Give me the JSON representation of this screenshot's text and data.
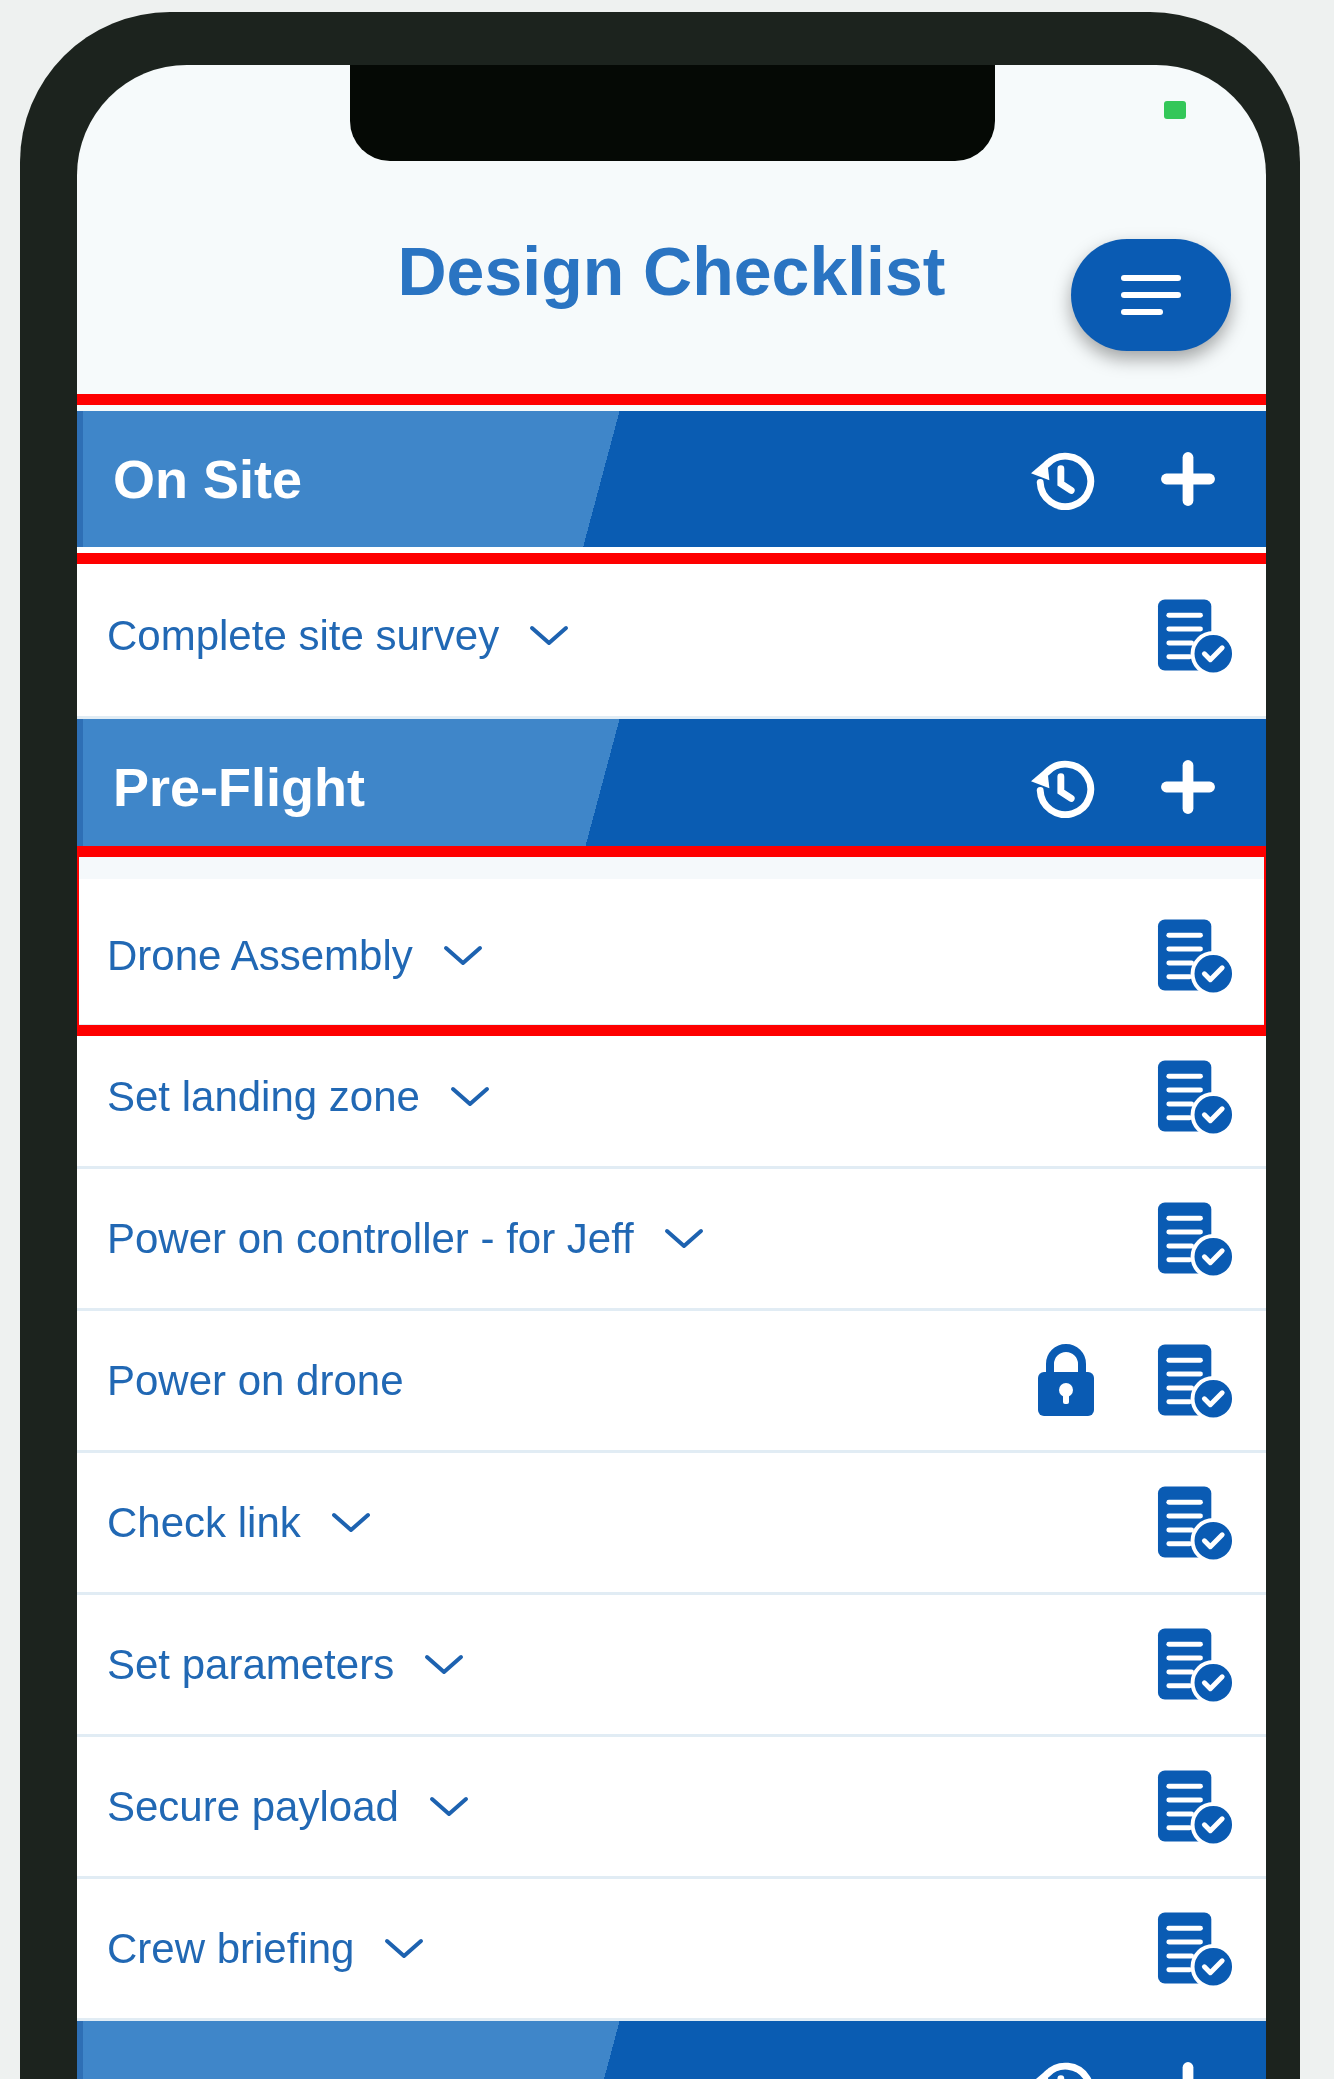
{
  "status_bar": {
    "charging": true
  },
  "title": "Design Checklist",
  "sections": [
    {
      "title": "On Site",
      "highlighted": true,
      "items": [
        {
          "label": "Complete site survey",
          "expandable": true,
          "locked": false,
          "highlighted": false
        }
      ]
    },
    {
      "title": "Pre-Flight",
      "highlighted": false,
      "items": [
        {
          "label": "Drone Assembly",
          "expandable": true,
          "locked": false,
          "highlighted": true
        },
        {
          "label": "Set landing zone",
          "expandable": true,
          "locked": false,
          "highlighted": false
        },
        {
          "label": "Power on controller - for Jeff",
          "expandable": true,
          "locked": false,
          "highlighted": false
        },
        {
          "label": "Power on drone",
          "expandable": false,
          "locked": true,
          "highlighted": false
        },
        {
          "label": "Check link",
          "expandable": true,
          "locked": false,
          "highlighted": false
        },
        {
          "label": "Set parameters",
          "expandable": true,
          "locked": false,
          "highlighted": false
        },
        {
          "label": "Secure payload",
          "expandable": true,
          "locked": false,
          "highlighted": false
        },
        {
          "label": "Crew briefing",
          "expandable": true,
          "locked": false,
          "highlighted": false
        }
      ]
    },
    {
      "highlighted": false
    }
  ]
}
